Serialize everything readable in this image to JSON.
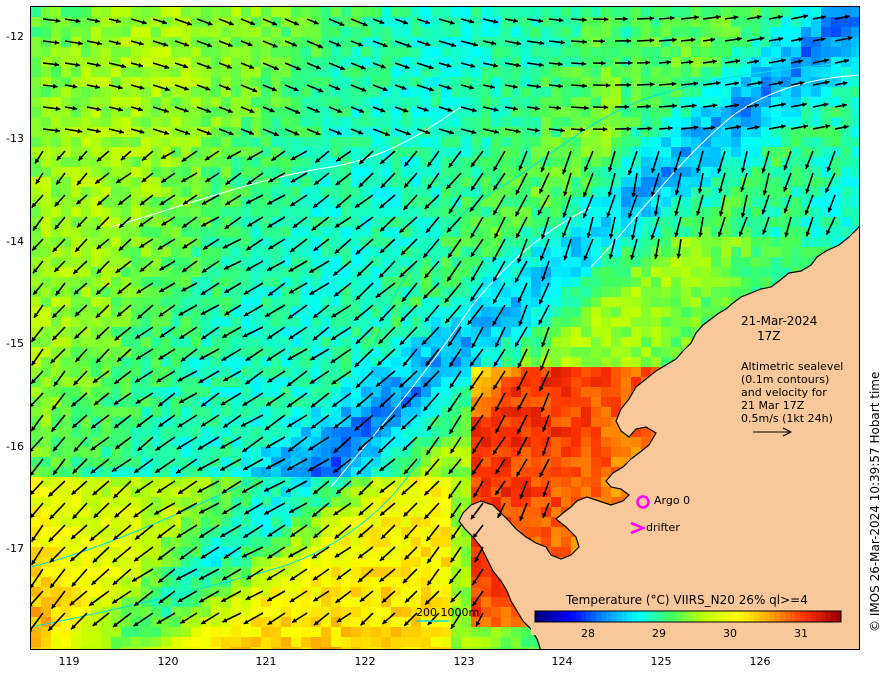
{
  "map": {
    "y_ticks": [
      "-12",
      "-13",
      "-14",
      "-15",
      "-16",
      "-17"
    ],
    "x_ticks": [
      "119",
      "120",
      "121",
      "122",
      "123",
      "124",
      "125",
      "126"
    ],
    "lat_range": [
      -17.95,
      -11.7
    ],
    "lon_range": [
      118.6,
      126.98
    ]
  },
  "annotation": {
    "date": "21-Mar-2024",
    "hour": "17Z",
    "sealevel_lines": [
      "Altimetric sealevel",
      "(0.1m contours)",
      "and velocity for",
      "21 Mar 17Z",
      "0.5m/s (1kt 24h)"
    ]
  },
  "legend": {
    "argo_label": "Argo 0",
    "drifter_label": "drifter",
    "contour_label": "200  1000m",
    "argo_color": "#ff00ff",
    "drifter_color": "#ff00ff",
    "contour_color": "#00e0e0"
  },
  "colorbar": {
    "title": "Temperature (°C) VIIRS_N20 26% ql>=4",
    "ticks": [
      "28",
      "29",
      "30",
      "31"
    ],
    "tick_values": [
      28,
      29,
      30,
      31
    ],
    "range": [
      27.3,
      31.6
    ],
    "stops": [
      "#00007f",
      "#0000ff",
      "#0090ff",
      "#00ffff",
      "#40ff60",
      "#c0ff00",
      "#ffff00",
      "#ffa000",
      "#ff3000",
      "#a00000"
    ]
  },
  "copyright": "© IMOS 26-Mar-2024 10:39:57 Hobart time",
  "colors": {
    "land": "#f8c89a",
    "coastline": "#000000",
    "arrows": "#000000",
    "sealevel_contours": "#ffffff"
  }
}
